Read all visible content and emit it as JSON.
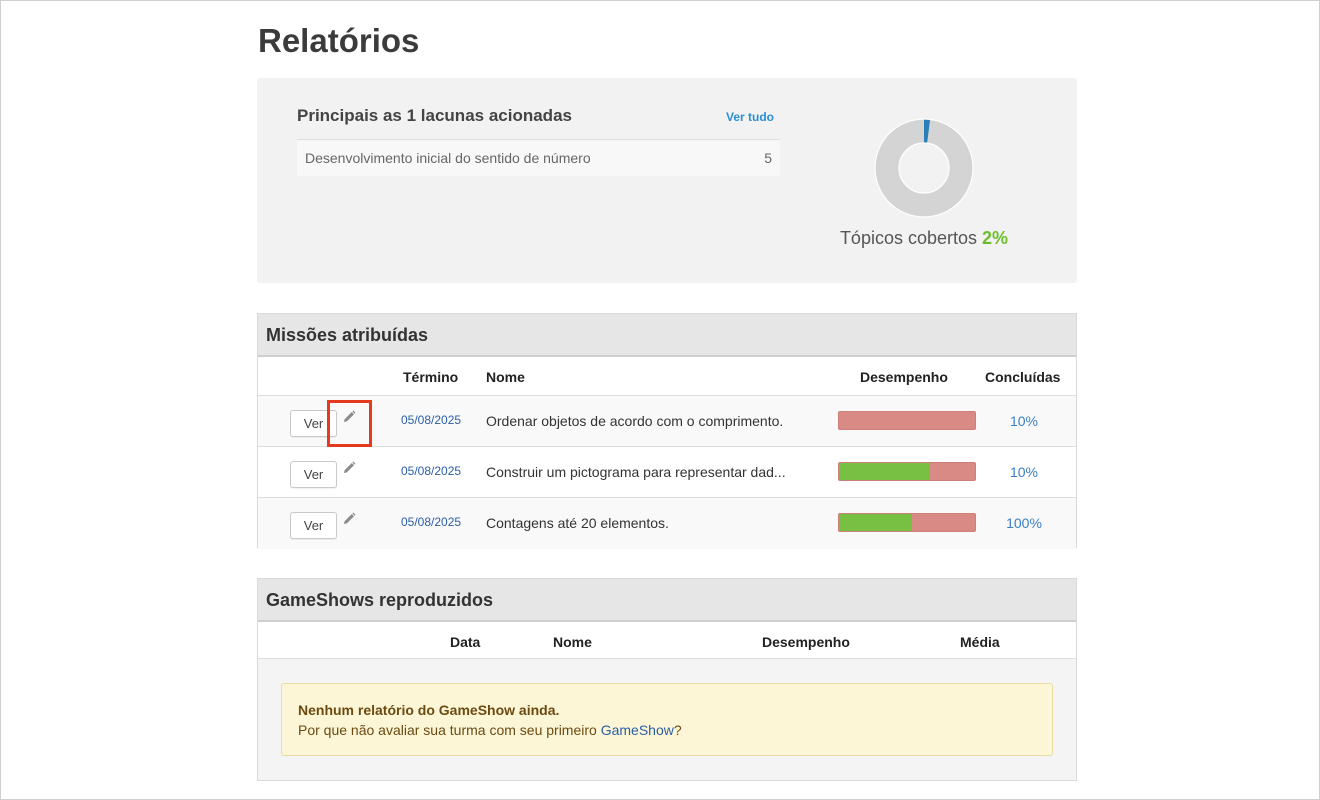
{
  "page": {
    "title": "Relatórios"
  },
  "summary": {
    "gaps_title": "Principais as 1 lacunas acionadas",
    "view_all": "Ver tudo",
    "gaps": [
      {
        "name": "Desenvolvimento inicial do sentido de número",
        "count": "5"
      }
    ],
    "coverage_label": "Tópicos cobertos",
    "coverage_value": "2%",
    "coverage_fraction": 0.02,
    "colors": {
      "covered": "#2a7fb8",
      "remaining": "#d4d4d4"
    }
  },
  "assignments": {
    "title": "Missões atribuídas",
    "columns": {
      "end": "Término",
      "name": "Nome",
      "performance": "Desempenho",
      "completed": "Concluídas"
    },
    "rows": [
      {
        "button": "Ver",
        "date": "05/08/2025",
        "name": "Ordenar objetos de acordo com o comprimento.",
        "performance": 0.0,
        "completed": "10%"
      },
      {
        "button": "Ver",
        "date": "05/08/2025",
        "name": "Construir um pictograma para representar dad...",
        "performance": 0.67,
        "completed": "10%"
      },
      {
        "button": "Ver",
        "date": "05/08/2025",
        "name": "Contagens até 20 elementos.",
        "performance": 0.54,
        "completed": "100%"
      }
    ]
  },
  "gameshows": {
    "title": "GameShows reproduzidos",
    "columns": {
      "date": "Data",
      "name": "Nome",
      "performance": "Desempenho",
      "average": "Média"
    },
    "empty": {
      "title": "Nenhum relatório do GameShow ainda.",
      "text_before": "Por que não avaliar sua turma com seu primeiro ",
      "link": "GameShow",
      "text_after": "?"
    }
  },
  "colors": {
    "perf_good": "#77c043",
    "perf_bad": "#d98a85",
    "link": "#2b5ea8",
    "highlight": "#e43b1e"
  }
}
